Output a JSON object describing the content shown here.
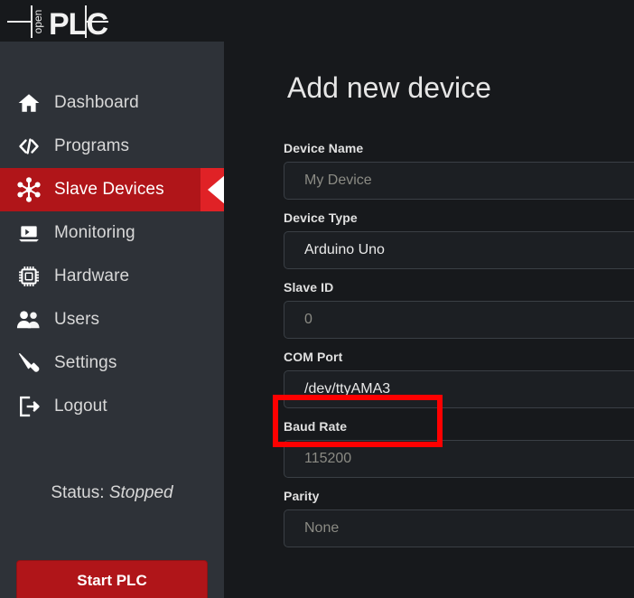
{
  "brand": {
    "logo_text_small": "open",
    "logo_text_large": "PLC",
    "logo_name": "openplc-logo"
  },
  "sidebar": {
    "items": [
      {
        "label": "Dashboard",
        "icon": "home-icon",
        "active": false
      },
      {
        "label": "Programs",
        "icon": "code-icon",
        "active": false
      },
      {
        "label": "Slave Devices",
        "icon": "atom-network-icon",
        "active": true
      },
      {
        "label": "Monitoring",
        "icon": "laptop-icon",
        "active": false
      },
      {
        "label": "Hardware",
        "icon": "chip-icon",
        "active": false
      },
      {
        "label": "Users",
        "icon": "users-icon",
        "active": false
      },
      {
        "label": "Settings",
        "icon": "wrench-icon",
        "active": false
      },
      {
        "label": "Logout",
        "icon": "logout-icon",
        "active": false
      }
    ],
    "status_prefix": "Status:",
    "status_value": "Stopped",
    "start_button": "Start PLC"
  },
  "main": {
    "title": "Add new device",
    "fields": [
      {
        "label": "Device Name",
        "value": "My Device",
        "filled": false
      },
      {
        "label": "Device Type",
        "value": "Arduino Uno",
        "filled": true
      },
      {
        "label": "Slave ID",
        "value": "0",
        "filled": false
      },
      {
        "label": "COM Port",
        "value": "/dev/ttyAMA3",
        "filled": true
      },
      {
        "label": "Baud Rate",
        "value": "115200",
        "filled": false
      },
      {
        "label": "Parity",
        "value": "None",
        "filled": false
      }
    ]
  },
  "annotation": {
    "name": "com-port-highlight",
    "color": "#fe0000",
    "target_field": "COM Port"
  },
  "colors": {
    "sidebar_bg": "#2e3238",
    "content_bg": "#17191c",
    "accent_red": "#b01519",
    "accent_red_bright": "#e02226",
    "annotation_red": "#fe0000",
    "input_bg": "#1c1f23",
    "input_border": "#3a3f45"
  }
}
